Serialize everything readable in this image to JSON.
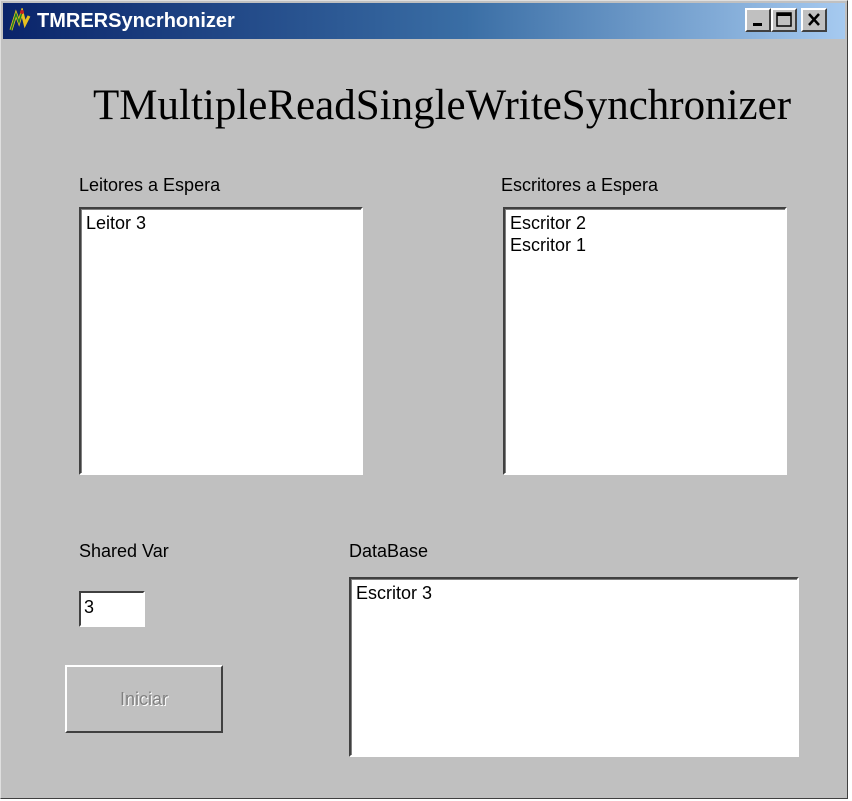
{
  "window": {
    "title": "TMRERSyncrhonizer",
    "icons": {
      "app": "application-icon",
      "minimize": "minimize-icon",
      "maximize": "maximize-icon",
      "close": "close-icon"
    }
  },
  "heading": "TMultipleReadSingleWriteSynchronizer",
  "readers": {
    "label": "Leitores a Espera",
    "items": [
      "Leitor 3"
    ]
  },
  "writers": {
    "label": "Escritores a Espera",
    "items": [
      "Escritor 2",
      "Escritor 1"
    ]
  },
  "shared_var": {
    "label": "Shared Var",
    "value": "3"
  },
  "database": {
    "label": "DataBase",
    "items": [
      "Escritor 3"
    ]
  },
  "start_button": {
    "label": "Iniciar",
    "enabled": false
  },
  "colors": {
    "face": "#c0c0c0",
    "title_start": "#0a246a",
    "title_end": "#a6caf0",
    "disabled_text": "#808080"
  }
}
